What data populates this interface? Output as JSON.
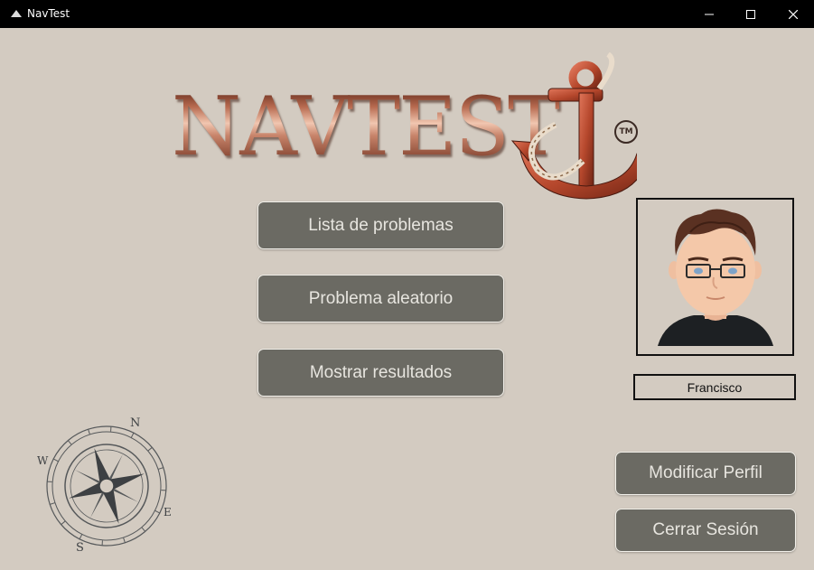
{
  "window": {
    "title": "NavTest"
  },
  "logo": {
    "text": "NAVTEST",
    "trademark": "TM"
  },
  "menu": {
    "problem_list": "Lista de problemas",
    "random_problem": "Problema aleatorio",
    "show_results": "Mostrar resultados"
  },
  "profile": {
    "username": "Francisco",
    "edit_profile": "Modificar Perfil",
    "logout": "Cerrar Sesión"
  },
  "compass": {
    "north": "N",
    "south": "S",
    "east": "E",
    "west": "W"
  },
  "colors": {
    "background": "#d3cbc1",
    "button": "#6b6a63",
    "button_text": "#e7e5df",
    "titlebar": "#000000",
    "logo_copper": "#c07a62",
    "anchor_red": "#b5472c"
  }
}
